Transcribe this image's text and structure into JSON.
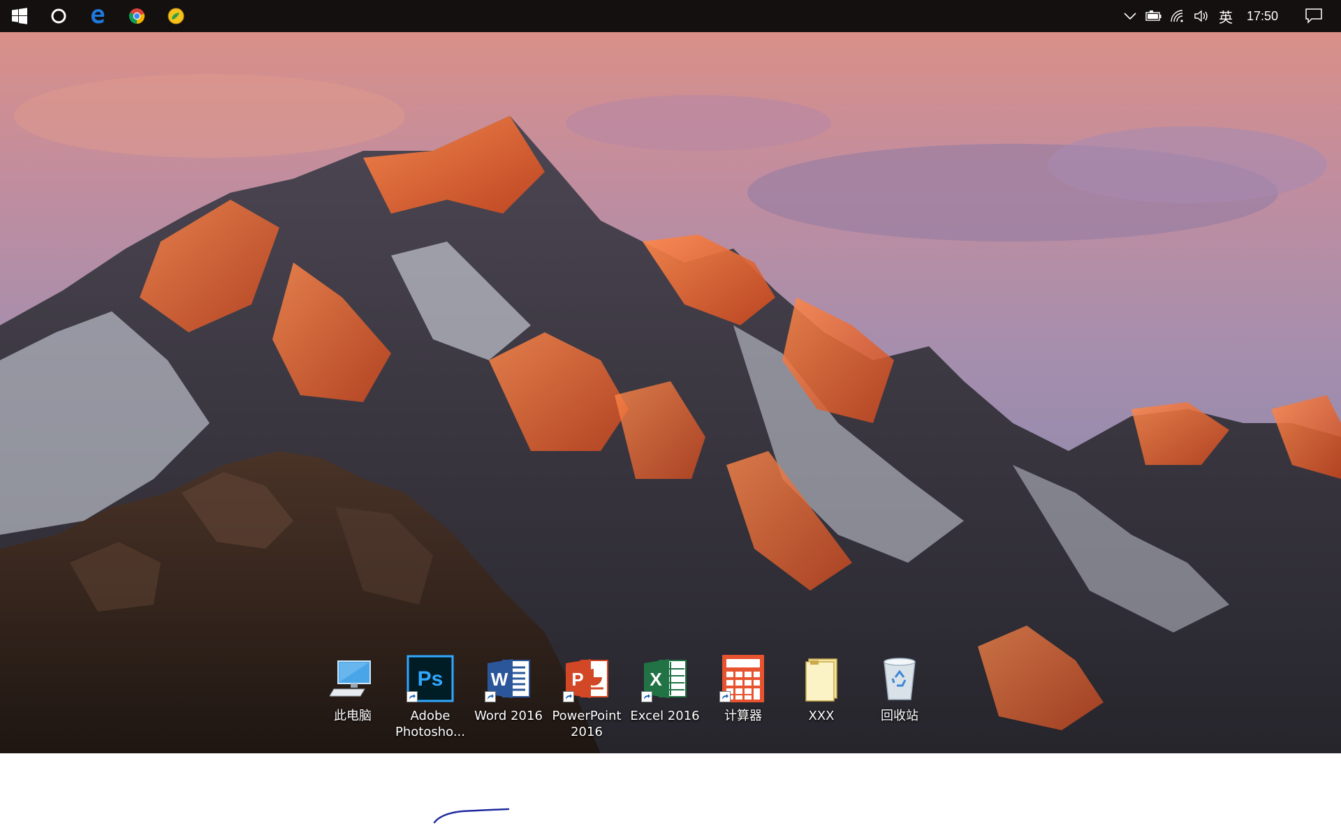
{
  "taskbar": {
    "left_icons": [
      {
        "name": "windows-start-icon"
      },
      {
        "name": "cortana-search-icon"
      },
      {
        "name": "edge-browser-icon"
      },
      {
        "name": "chrome-browser-icon"
      },
      {
        "name": "app-icon"
      }
    ],
    "tray": {
      "ime_label": "英",
      "time": "17:50"
    }
  },
  "desktop": {
    "icons": [
      {
        "label": "此电脑",
        "icon": "this-pc-icon"
      },
      {
        "label": "Adobe\nPhotosho...",
        "icon": "photoshop-icon"
      },
      {
        "label": "Word 2016",
        "icon": "word-icon"
      },
      {
        "label": "PowerPoint\n2016",
        "icon": "powerpoint-icon"
      },
      {
        "label": "Excel 2016",
        "icon": "excel-icon"
      },
      {
        "label": "计算器",
        "icon": "calculator-icon"
      },
      {
        "label": "XXX",
        "icon": "file-icon"
      },
      {
        "label": "回收站",
        "icon": "recycle-bin-icon"
      }
    ]
  },
  "colors": {
    "taskbar_bg": "#14100f",
    "ps_blue": "#31a8ff",
    "word_blue": "#2b579a",
    "ppt_orange": "#d24726",
    "excel_green": "#217346",
    "calc_orange": "#e8532f",
    "pen_stroke": "#1f2a9e"
  }
}
